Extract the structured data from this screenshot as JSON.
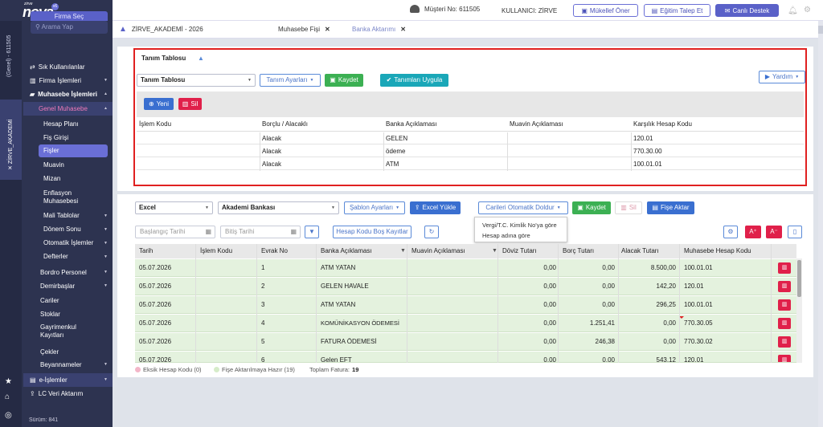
{
  "brand": {
    "small": "zirve",
    "name": "nova",
    "version": "v6",
    "firma_button": "Firma Seç"
  },
  "topbar": {
    "customer_no": "Müşteri No: 611505",
    "user": "KULLANICI: ZİRVE",
    "buttons": [
      "Mükellef Öner",
      "Eğitim Talep Et",
      "Canlı Destek"
    ]
  },
  "vertical": {
    "top": "(Genel) - 611505",
    "company": "ZİRVE_AKADEMİ"
  },
  "sidebar": {
    "search_placeholder": "Arama Yap",
    "items": [
      "Sık Kullanılanlar",
      "Firma İşlemleri",
      "Muhasebe İşlemleri",
      "Genel Muhasebe"
    ],
    "sub": [
      "Hesap Planı",
      "Fiş Girişi",
      "Fişler",
      "Muavin",
      "Mizan",
      "Enflasyon Muhasebesi",
      "Mali Tablolar",
      "Dönem Sonu",
      "Otomatik İşlemler",
      "Defterler"
    ],
    "lower": [
      "Bordro Personel",
      "Demirbaşlar",
      "Cariler",
      "Stoklar",
      "Gayrimenkul Kayıtları",
      "Çekler",
      "Beyannameler",
      "e-İşlemler",
      "LC Veri Aktarım"
    ],
    "version": "Sürüm: 841"
  },
  "tabs": {
    "company": "ZİRVE_AKADEMİ - 2026",
    "t1": "Muhasebe Fişi",
    "t2": "Banka Aktarımı"
  },
  "panel1": {
    "title": "Tanım Tablosu",
    "select": "Tanım Tablosu",
    "settings": "Tanım Ayarları",
    "save": "Kaydet",
    "apply": "Tanımları Uygula",
    "help": "Yardım",
    "new": "Yeni",
    "delete": "Sil",
    "columns": [
      "İşlem Kodu",
      "Borçlu / Alacaklı",
      "Banka Açıklaması",
      "Muavin Açıklaması",
      "Karşılık Hesap Kodu"
    ],
    "rows": [
      [
        "",
        "Alacak",
        "GELEN",
        "",
        "120.01"
      ],
      [
        "",
        "Alacak",
        "ödeme",
        "",
        "770.30.00"
      ],
      [
        "",
        "Alacak",
        "ATM",
        "",
        "100.01.01"
      ]
    ]
  },
  "panel2": {
    "format": "Excel",
    "bank": "Akademi Bankası",
    "template": "Şablon Ayarları",
    "excel_upload": "Excel Yükle",
    "auto_fill": "Carileri Otomatik Doldur",
    "save": "Kaydet",
    "delete": "Sil",
    "transfer": "Fişe Aktar",
    "start_date": "Başlangıç Tarihi",
    "end_date": "Bitiş Tarihi",
    "empty_records": "Hesap Kodu Boş Kayıtlar",
    "dropdown": [
      "Vergi/T.C. Kimlik No'ya göre",
      "Hesap adına göre"
    ],
    "columns": [
      "Tarih",
      "İşlem Kodu",
      "Evrak No",
      "Banka Açıklaması",
      "Muavin Açıklaması",
      "Döviz Tutarı",
      "Borç Tutarı",
      "Alacak Tutarı",
      "Muhasebe Hesap Kodu"
    ],
    "rows": [
      [
        "05.07.2026",
        "",
        "1",
        "ATM YATAN",
        "",
        "0,00",
        "0,00",
        "8.500,00",
        "100.01.01"
      ],
      [
        "05.07.2026",
        "",
        "2",
        "GELEN HAVALE",
        "",
        "0,00",
        "0,00",
        "142,20",
        "120.01"
      ],
      [
        "05.07.2026",
        "",
        "3",
        "ATM YATAN",
        "",
        "0,00",
        "0,00",
        "296,25",
        "100.01.01"
      ],
      [
        "05.07.2026",
        "",
        "4",
        "KOMÜNİKASYON ÖDEMESİ",
        "",
        "0,00",
        "1.251,41",
        "0,00",
        "770.30.05"
      ],
      [
        "05.07.2026",
        "",
        "5",
        "FATURA ÖDEMESİ",
        "",
        "0,00",
        "246,38",
        "0,00",
        "770.30.02"
      ],
      [
        "05.07.2026",
        "",
        "6",
        "Gelen EFT",
        "",
        "0,00",
        "0,00",
        "543,12",
        "120.01"
      ]
    ],
    "legend": {
      "missing": "Eksik Hesap Kodu (0)",
      "ready": "Fişe Aktarılmaya Hazır (19)",
      "total_label": "Toplam Fatura:",
      "total": "19"
    }
  }
}
